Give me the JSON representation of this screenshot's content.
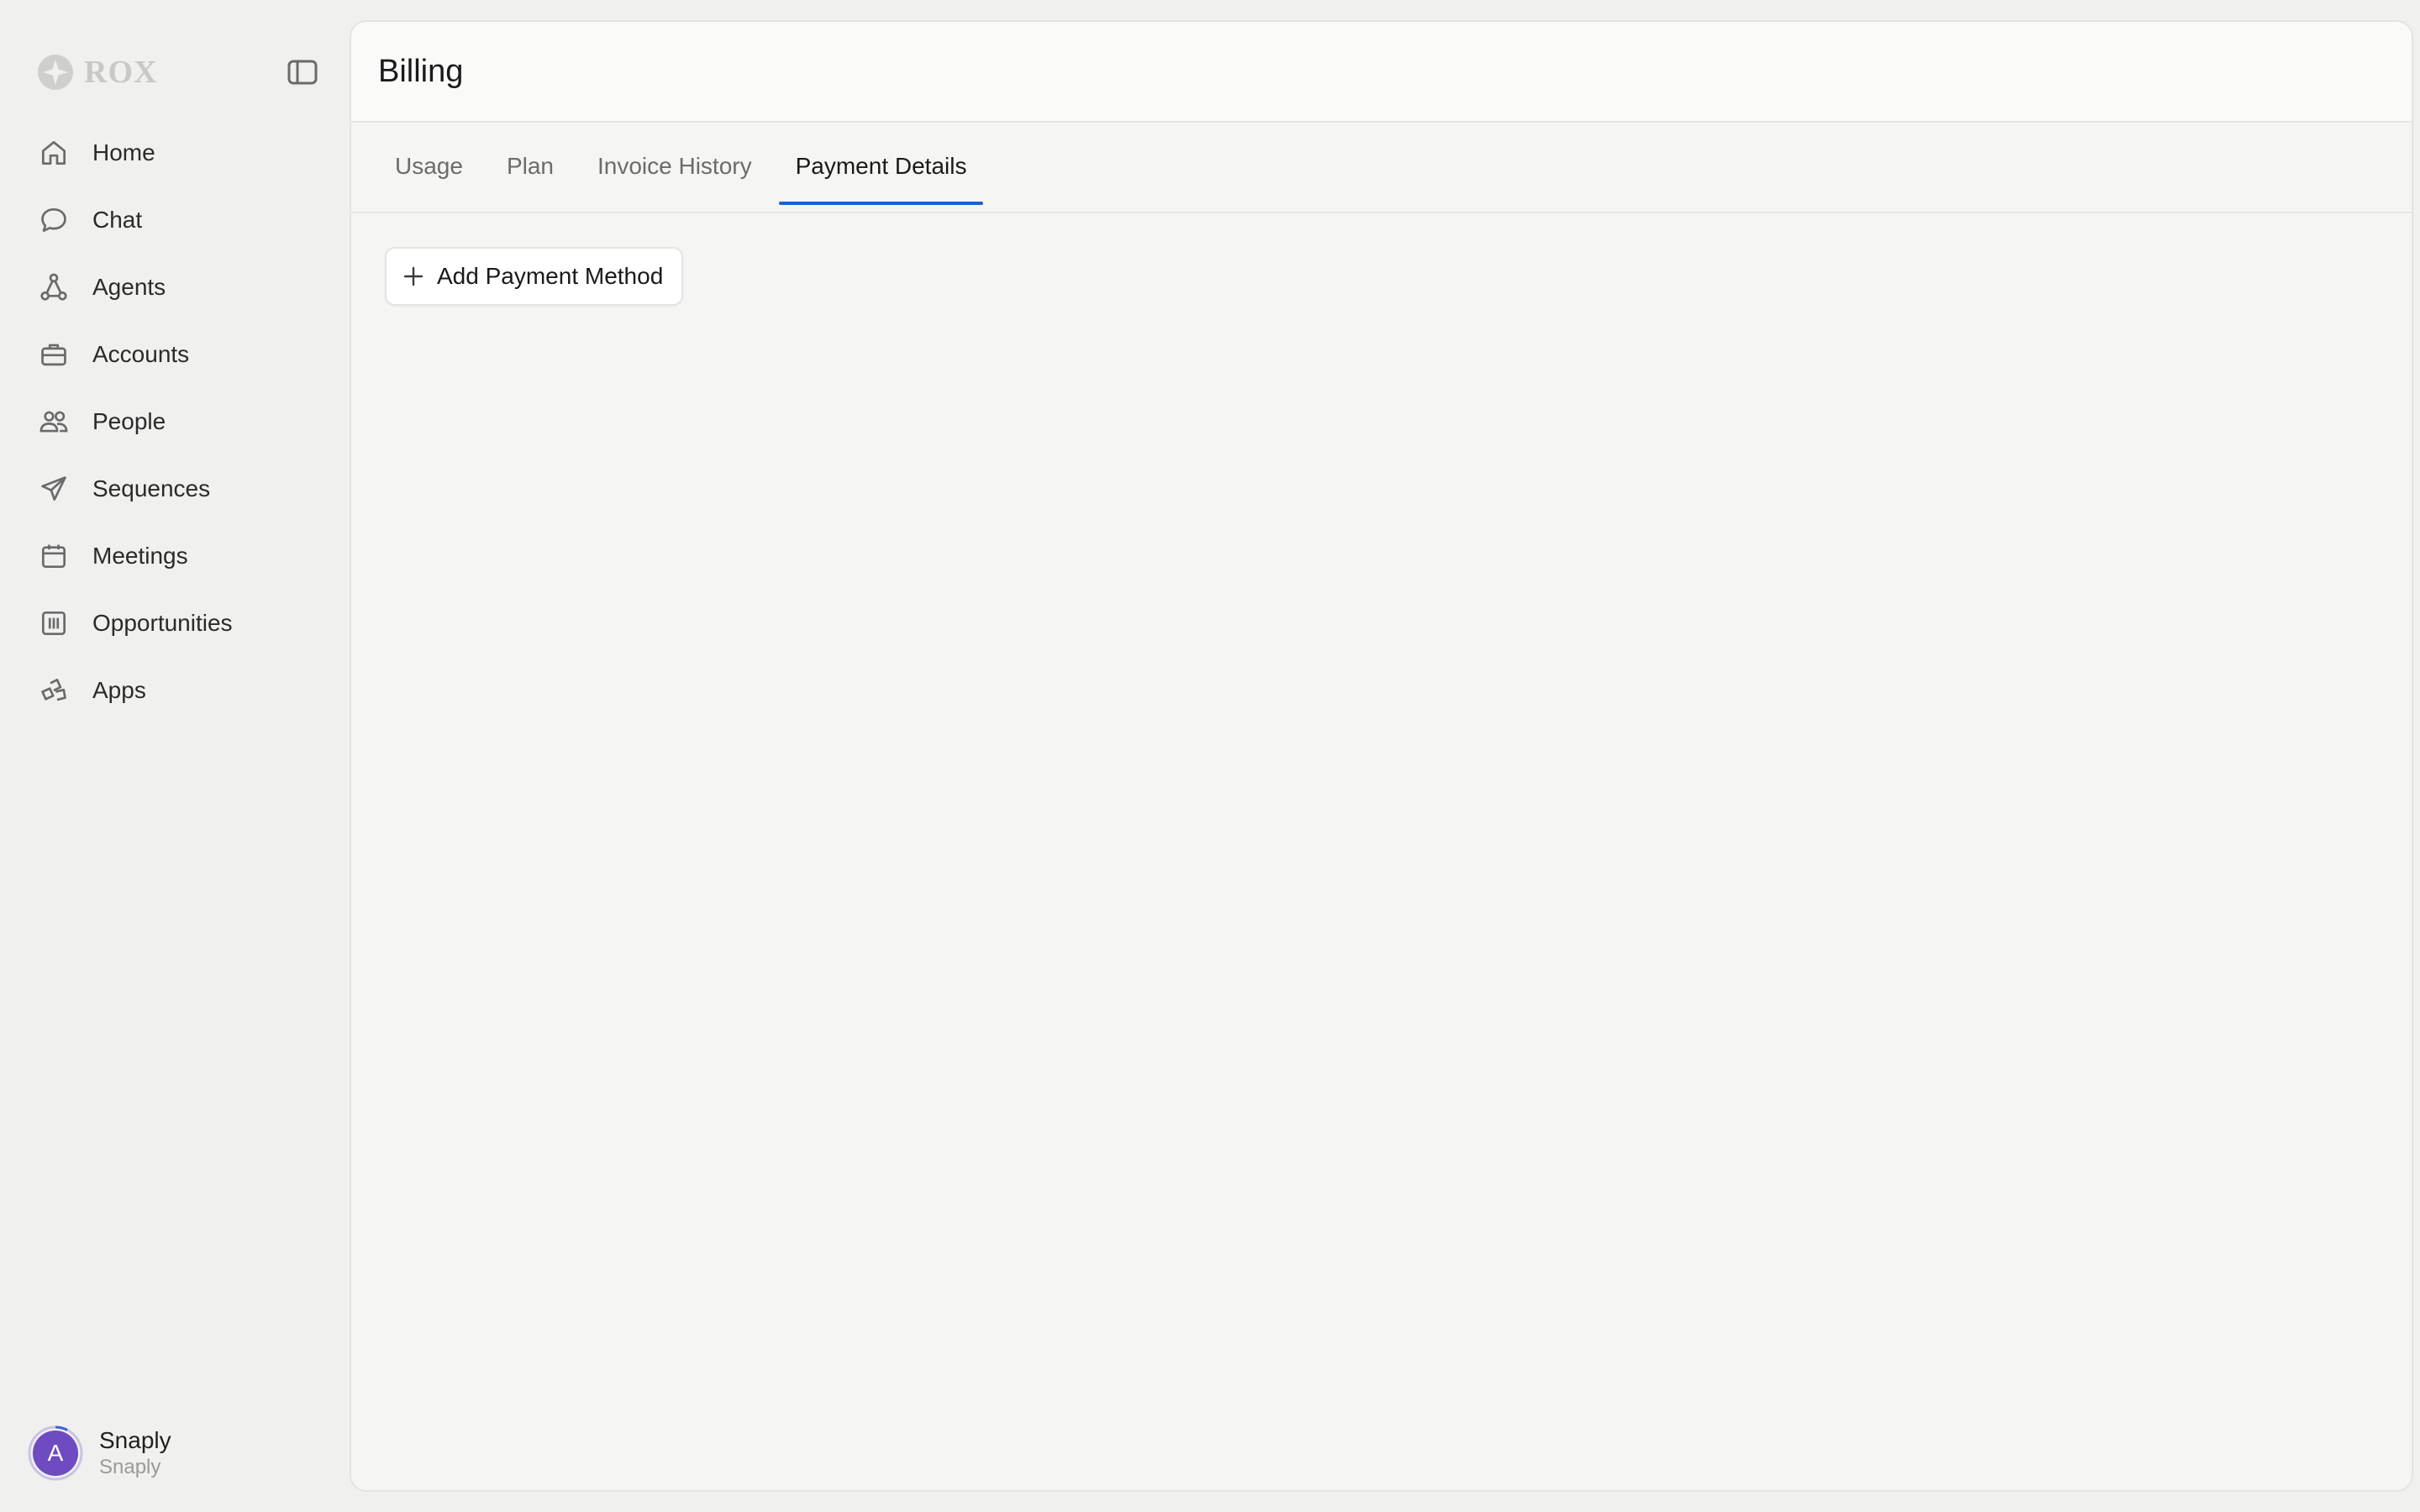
{
  "brand": {
    "name": "ROX",
    "icon": "rox-logo-icon"
  },
  "sidebar": {
    "collapse_icon": "sidebar-toggle-icon",
    "items": [
      {
        "label": "Home",
        "icon": "home-icon"
      },
      {
        "label": "Chat",
        "icon": "chat-bubble-icon"
      },
      {
        "label": "Agents",
        "icon": "agents-network-icon"
      },
      {
        "label": "Accounts",
        "icon": "briefcase-icon"
      },
      {
        "label": "People",
        "icon": "people-icon"
      },
      {
        "label": "Sequences",
        "icon": "paper-plane-icon"
      },
      {
        "label": "Meetings",
        "icon": "calendar-icon"
      },
      {
        "label": "Opportunities",
        "icon": "kanban-icon"
      },
      {
        "label": "Apps",
        "icon": "apps-icon"
      }
    ]
  },
  "user": {
    "initial": "A",
    "name": "Snaply",
    "org": "Snaply",
    "avatar_color": "#6e4bc0"
  },
  "header": {
    "title": "Billing"
  },
  "tabs": [
    {
      "label": "Usage",
      "active": false
    },
    {
      "label": "Plan",
      "active": false
    },
    {
      "label": "Invoice History",
      "active": false
    },
    {
      "label": "Payment Details",
      "active": true
    }
  ],
  "actions": {
    "add_payment_label": "Add Payment Method"
  },
  "colors": {
    "accent": "#1f5fd6",
    "background": "#f0f0ef",
    "panel": "#f5f5f3"
  }
}
